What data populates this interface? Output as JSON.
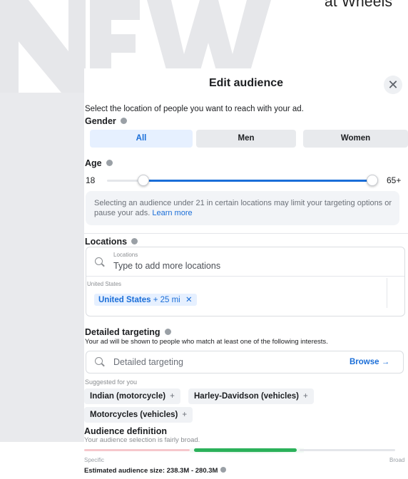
{
  "overlay": {
    "brand_text": "at Wheels",
    "watermark_word": "NEW"
  },
  "dialog": {
    "title": "Edit audience",
    "close_glyph": "✕",
    "description": "Select the location of people you want to reach with your ad."
  },
  "gender": {
    "label": "Gender",
    "options": [
      "All",
      "Men",
      "Women"
    ],
    "selected": "All"
  },
  "age": {
    "label": "Age",
    "min_label": "18",
    "max_label": "65+",
    "min_value": 18,
    "max_value": 65
  },
  "age_notice": {
    "text": "Selecting an audience under 21 in certain locations may limit your targeting options or pause your ads.",
    "link": "Learn more"
  },
  "locations": {
    "label": "Locations",
    "input_caption": "Locations",
    "input_placeholder": "Type to add more locations",
    "group_label": "United States",
    "chip_name": "United States",
    "chip_distance": "+ 25 mi",
    "chip_remove": "✕"
  },
  "detailed_targeting": {
    "label": "Detailed targeting",
    "description": "Your ad will be shown to people who match at least one of the following interests.",
    "input_placeholder": "Detailed targeting",
    "browse_label": "Browse →",
    "suggested_label": "Suggested for you",
    "suggestions": [
      {
        "label": "Indian (motorcycle)",
        "action": "+"
      },
      {
        "label": "Harley-Davidson (vehicles)",
        "action": "+"
      },
      {
        "label": "Motorcycles (vehicles)",
        "action": "+"
      }
    ]
  },
  "audience_definition": {
    "label": "Audience definition",
    "description": "Your audience selection is fairly broad.",
    "scale_min": "Specific",
    "scale_max": "Broad",
    "estimated_size": "Estimated audience size: 238.3M - 280.3M"
  },
  "icons": {
    "close": "close-icon",
    "info": "info-icon",
    "search": "search-icon"
  },
  "colors": {
    "accent": "#1a6ed8",
    "meter_good": "#2bb15a",
    "meter_low": "#f6c7cc",
    "muted_bg": "#f0f2f5",
    "watermark": "#e6e7ea"
  }
}
